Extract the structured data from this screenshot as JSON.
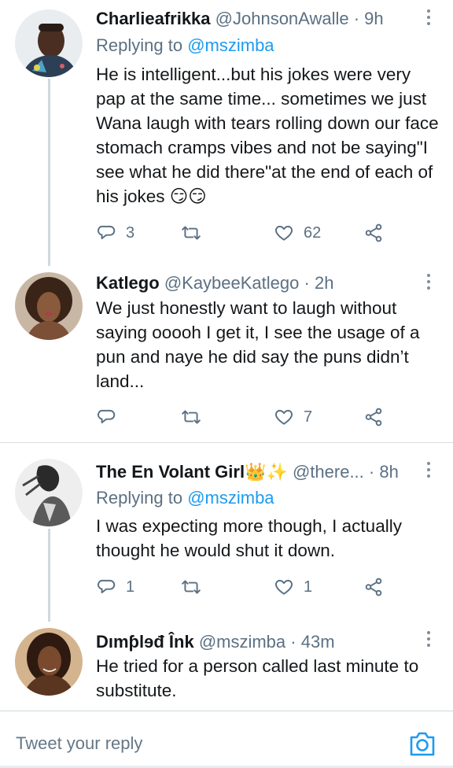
{
  "tweets": [
    {
      "name": "Charlieafrikka",
      "handle": "@JohnsonAwalle",
      "sep": "·",
      "time": "9h",
      "replying_prefix": "Replying to",
      "replying_to": "@mszimba",
      "text": "He is intelligent...but his jokes were very pap at the same time... sometimes we just Wana laugh with tears rolling down our face stomach cramps vibes and not be saying\"I see what he did there\"at the end of each of his jokes 😏😏",
      "replies": "3",
      "retweets": "",
      "likes": "62"
    },
    {
      "name": "Katlego",
      "handle": "@KaybeeKatlego",
      "sep": "·",
      "time": "2h",
      "text": "We just honestly want to laugh without saying ooooh I get it, I see the usage of a pun and naye he did say the puns didn’t land...",
      "replies": "",
      "retweets": "",
      "likes": "7"
    },
    {
      "name": "The En Volant Girl👑✨",
      "handle": "@there...",
      "sep": "·",
      "time": "8h",
      "replying_prefix": "Replying to",
      "replying_to": "@mszimba",
      "text": "I was expecting more though, I actually thought he would shut it down.",
      "replies": "1",
      "retweets": "",
      "likes": "1"
    },
    {
      "name": "Dımƥlɘđ Înk",
      "handle": "@mszimba",
      "sep": "·",
      "time": "43m",
      "text": "He tried for a person called last minute to substitute."
    }
  ],
  "reply_bar": {
    "placeholder": "Tweet your reply"
  },
  "colors": {
    "accent": "#1d9bf0",
    "muted": "#5b7083",
    "text": "#14171a",
    "divider": "#cfd9de"
  },
  "icons": [
    "reply-icon",
    "retweet-icon",
    "like-icon",
    "share-icon",
    "more-icon",
    "camera-icon"
  ]
}
